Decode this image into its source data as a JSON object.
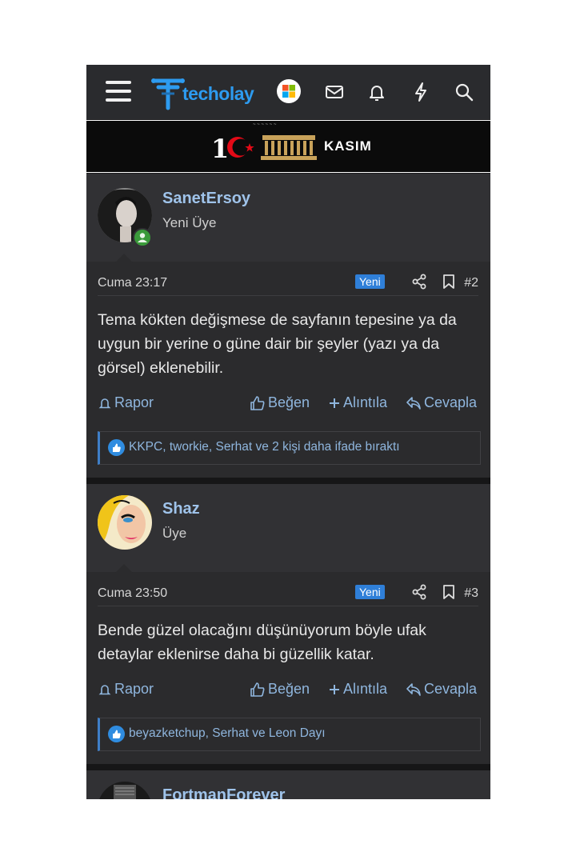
{
  "header": {
    "logo_text": "techolay",
    "icons": [
      "menu-icon",
      "user-avatar",
      "mail-icon",
      "bell-icon",
      "bolt-icon",
      "search-icon"
    ]
  },
  "banner": {
    "number": "10",
    "month": "KASIM"
  },
  "posts": [
    {
      "username": "SanetErsoy",
      "title": "Yeni Üye",
      "date": "Cuma 23:17",
      "badge": "Yeni",
      "number": "#2",
      "body": "Tema kökten değişmese de sayfanın tepesine ya da uygun bir yerine o güne dair bir şeyler (yazı ya da görsel) eklenebilir.",
      "actions": {
        "report": "Rapor",
        "like": "Beğen",
        "quote": "Alıntıla",
        "reply": "Cevapla"
      },
      "reactions": "KKPC, tworkie, Serhat ve 2 kişi daha ifade bıraktı"
    },
    {
      "username": "Shaz",
      "title": "Üye",
      "date": "Cuma 23:50",
      "badge": "Yeni",
      "number": "#3",
      "body": "Bende güzel olacağını düşünüyorum böyle ufak detaylar eklenirse daha bi güzellik katar.",
      "actions": {
        "report": "Rapor",
        "like": "Beğen",
        "quote": "Alıntıla",
        "reply": "Cevapla"
      },
      "reactions": "beyazketchup, Serhat ve Leon Dayı"
    },
    {
      "username": "FortmanForever"
    }
  ],
  "colors": {
    "accent": "#2f7fd8",
    "link": "#9fc3ea",
    "background": "#2b2b2d"
  }
}
